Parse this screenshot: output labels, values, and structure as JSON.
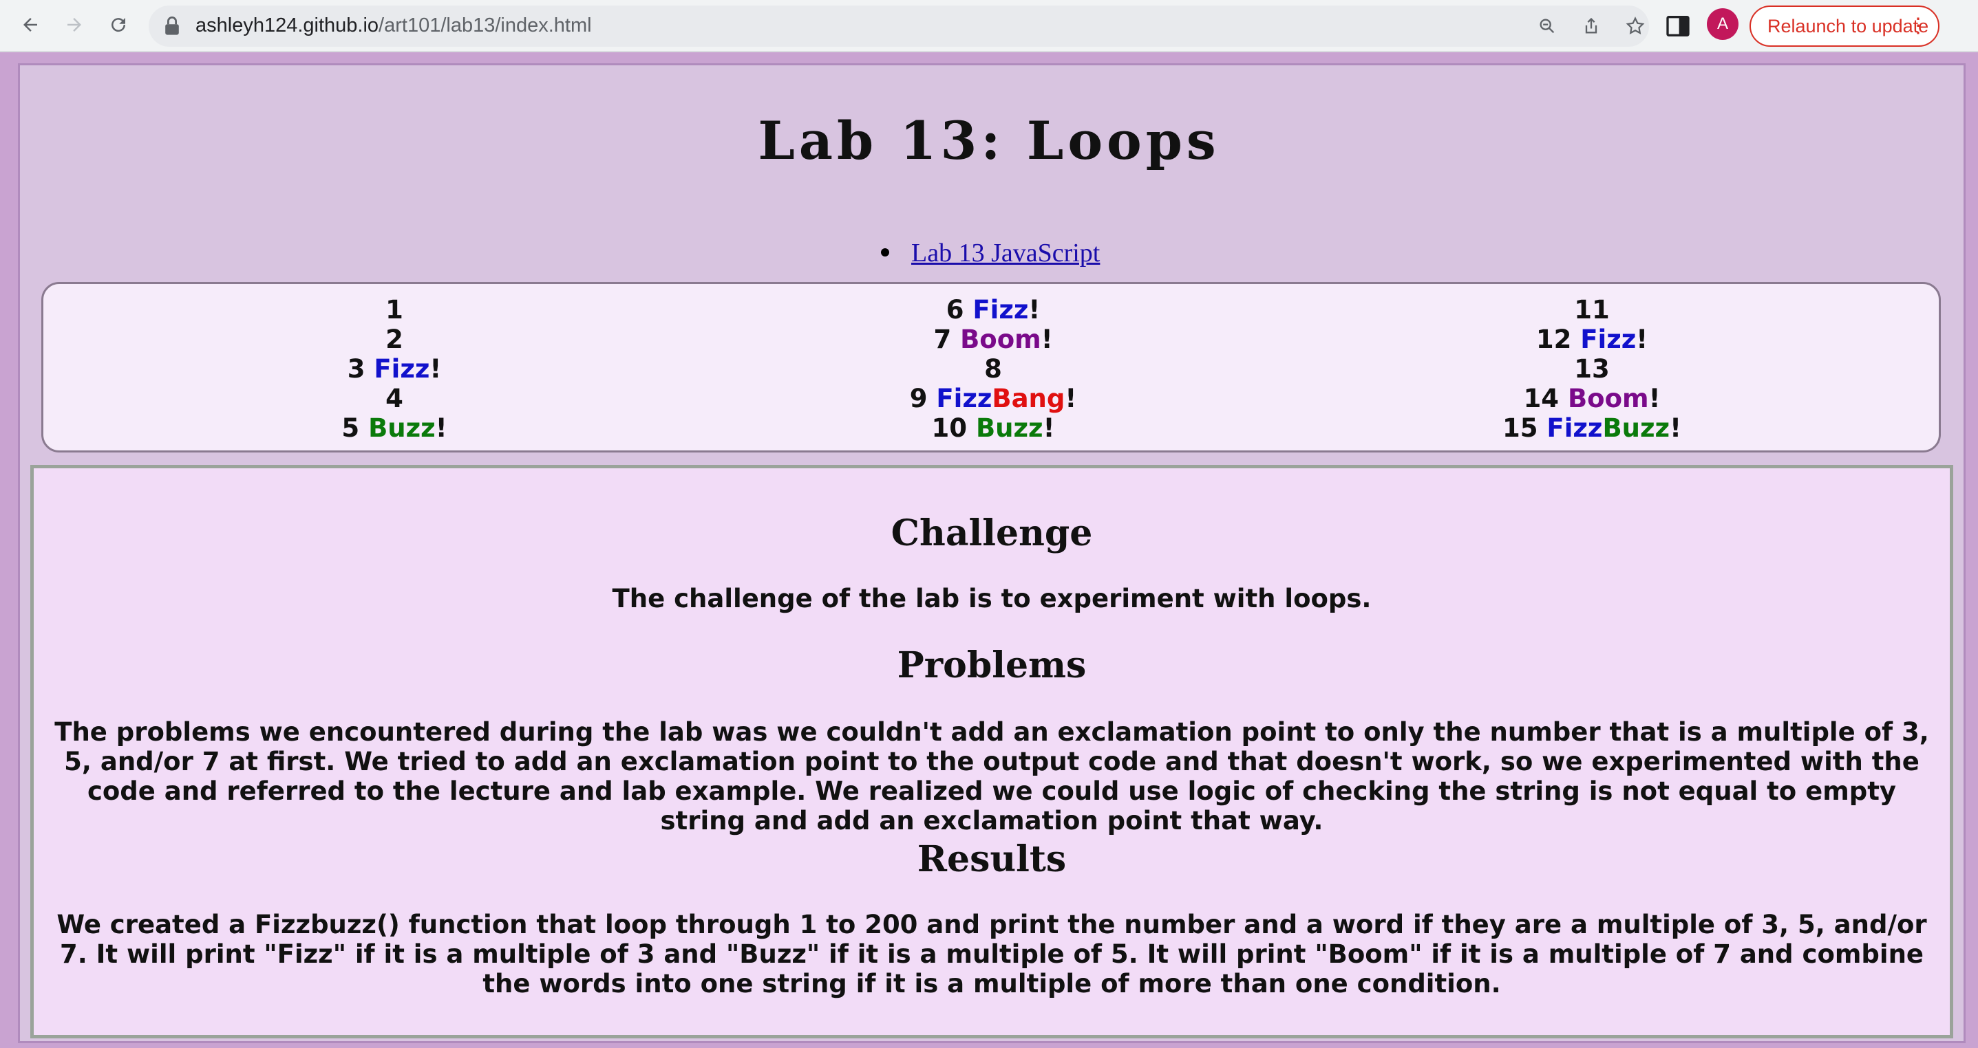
{
  "browser": {
    "url_host": "ashleyh124.github.io",
    "url_path": "/art101/lab13/index.html",
    "avatar_letter": "A",
    "relaunch_label": "Relaunch to update"
  },
  "page": {
    "title": "Lab 13: Loops",
    "link_label": "Lab 13 JavaScript"
  },
  "output": {
    "columns": [
      [
        {
          "n": "1",
          "word": "",
          "parts": []
        },
        {
          "n": "2",
          "parts": []
        },
        {
          "n": "3",
          "parts": [
            {
              "t": "Fizz",
              "c": "fizz"
            }
          ]
        },
        {
          "n": "4",
          "parts": []
        },
        {
          "n": "5",
          "parts": [
            {
              "t": "Buzz",
              "c": "buzz"
            }
          ]
        }
      ],
      [
        {
          "n": "6",
          "parts": [
            {
              "t": "Fizz",
              "c": "fizz"
            }
          ]
        },
        {
          "n": "7",
          "parts": [
            {
              "t": "Boom",
              "c": "boom"
            }
          ]
        },
        {
          "n": "8",
          "parts": []
        },
        {
          "n": "9",
          "parts": [
            {
              "t": "Fizz",
              "c": "fizz"
            },
            {
              "t": "Bang",
              "c": "bang"
            }
          ]
        },
        {
          "n": "10",
          "parts": [
            {
              "t": "Buzz",
              "c": "buzz"
            }
          ]
        }
      ],
      [
        {
          "n": "11",
          "parts": []
        },
        {
          "n": "12",
          "parts": [
            {
              "t": "Fizz",
              "c": "fizz"
            }
          ]
        },
        {
          "n": "13",
          "parts": []
        },
        {
          "n": "14",
          "parts": [
            {
              "t": "Boom",
              "c": "boom"
            }
          ]
        },
        {
          "n": "15",
          "parts": [
            {
              "t": "Fizz",
              "c": "fizz"
            },
            {
              "t": "Buzz",
              "c": "buzz"
            }
          ]
        }
      ]
    ],
    "colors": {
      "fizz": "#1111cc",
      "buzz": "#0a7a0a",
      "boom": "#7a0a8a",
      "bang": "#e01010"
    }
  },
  "notes": {
    "challenge_heading": "Challenge",
    "challenge_text": "The challenge of the lab is to experiment with loops.",
    "problems_heading": "Problems",
    "problems_text": "The problems we encountered during the lab was we couldn't add an exclamation point to only the number that is a multiple of 3, 5, and/or 7 at first. We tried to add an exclamation point to the output code and that doesn't work, so we experimented with the code and referred to the lecture and lab example. We realized we could use logic of checking the string is not equal to empty string and add an exclamation point that way.",
    "results_heading": "Results",
    "results_text": "We created a Fizzbuzz() function that loop through 1 to 200 and print the number and a word if they are a multiple of 3, 5, and/or 7. It will print \"Fizz\" if it is a multiple of 3 and \"Buzz\" if it is a multiple of 5. It will print \"Boom\" if it is a multiple of 7 and combine the words into one string if it is a multiple of more than one condition."
  }
}
